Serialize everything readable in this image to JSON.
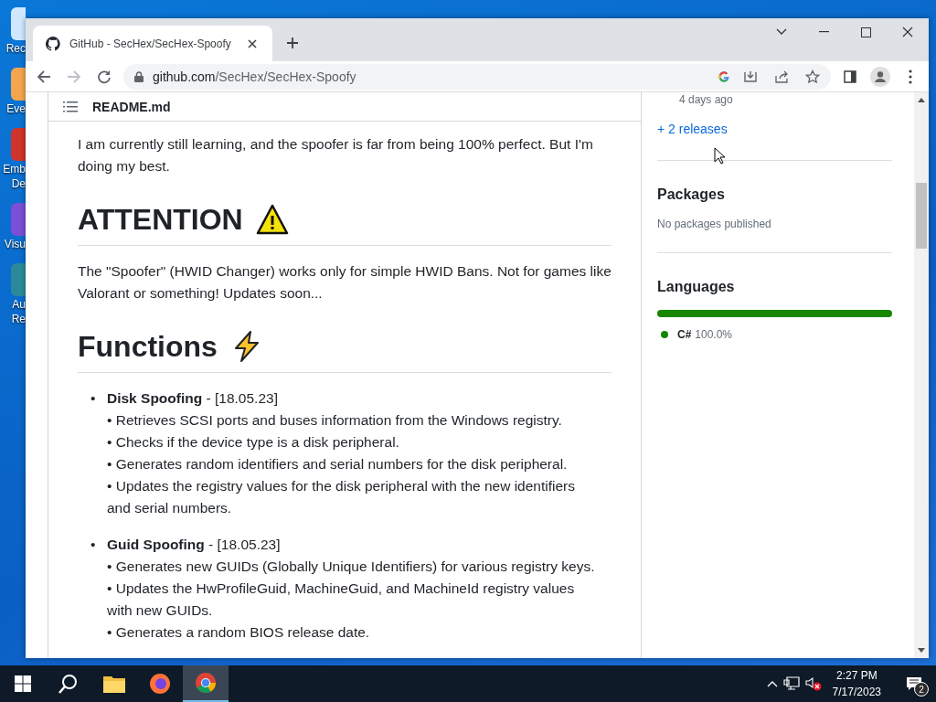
{
  "desktop_icons": [
    {
      "label": [
        "Rec"
      ]
    },
    {
      "label": [
        "Eve"
      ]
    },
    {
      "label": [
        "Emb",
        "De"
      ]
    },
    {
      "label": [
        "Visu"
      ]
    },
    {
      "label": [
        "Au",
        "Re"
      ]
    }
  ],
  "browser": {
    "tabs": [
      {
        "title": "GitHub - SecHex/SecHex-Spoofy",
        "selected": true
      }
    ],
    "address": {
      "domain": "github.com",
      "path": "/SecHex/SecHex-Spoofy"
    }
  },
  "readme": {
    "file": "README.md",
    "bullet": "•",
    "blocks": [
      {
        "kind": "paragraph",
        "text": "I am currently still learning, and the spoofer is far from being 100% perfect. But I'm doing my best."
      },
      {
        "kind": "heading",
        "text": "ATTENTION"
      },
      {
        "kind": "paragraph",
        "text": "The \"Spoofer\" (HWID Changer) works only for simple HWID Bans. Not for games like Valorant or something! Updates soon..."
      },
      {
        "kind": "heading",
        "text": "Functions"
      },
      {
        "kind": "list",
        "items": [
          {
            "title": "Disk Spoofing",
            "suffix": "- [18.05.23]",
            "lines": [
              "• Retrieves SCSI ports and buses information from the Windows registry.",
              "• Checks if the device type is a disk peripheral.",
              "• Generates random identifiers and serial numbers for the disk peripheral.",
              "• Updates the registry values for the disk peripheral with the new identifiers and serial numbers."
            ]
          },
          {
            "title": "Guid Spoofing",
            "suffix": "- [18.05.23]",
            "lines": [
              "• Generates new GUIDs (Globally Unique Identifiers) for various registry keys.",
              "• Updates the HwProfileGuid, MachineGuid, and MachineId registry values with new GUIDs.",
              "• Generates a random BIOS release date."
            ]
          }
        ]
      }
    ]
  },
  "sidebar": {
    "release_age": "4 days ago",
    "releases_link": "+ 2 releases",
    "packages": {
      "title": "Packages",
      "empty": "No packages published"
    },
    "languages": {
      "title": "Languages",
      "items": [
        {
          "name": "C#",
          "percent": "100.0%",
          "level": 1.0,
          "color": "#178600"
        }
      ]
    }
  },
  "taskbar": {
    "time": "2:27 PM",
    "date": "7/17/2023",
    "notifications": "2"
  }
}
